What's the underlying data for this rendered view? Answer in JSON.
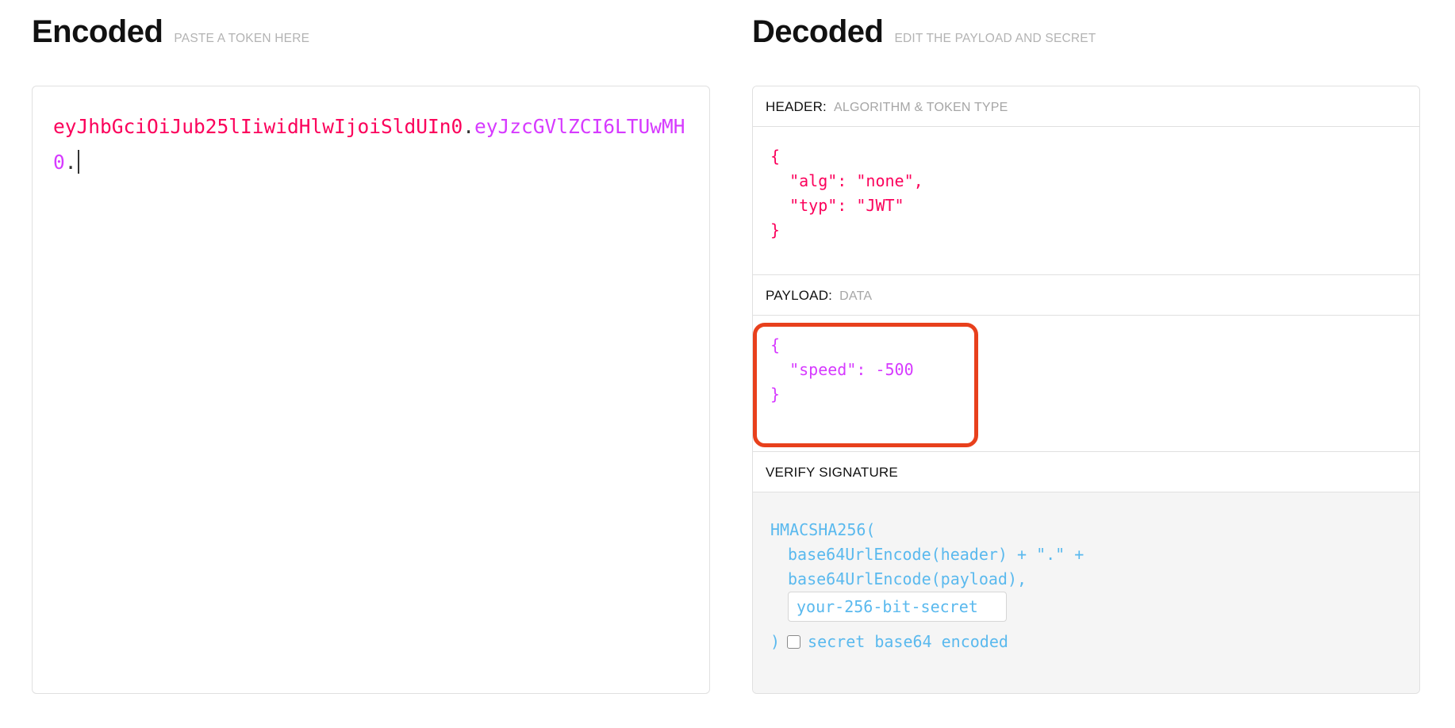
{
  "encoded": {
    "title": "Encoded",
    "subtitle": "PASTE A TOKEN HERE",
    "token_header_part": "eyJhbGciOiJub25lIiwidHlwIjoiSldUIn0",
    "token_separator_1": ".",
    "token_payload_part": "eyJzcGVlZCI6LTUwMH0",
    "token_separator_2": ".",
    "token_full": "eyJhbGciOiJub25lIiwidHlwIjoiSldUIn0.eyJzcGVlZCI6LTUwMH0."
  },
  "decoded": {
    "title": "Decoded",
    "subtitle": "EDIT THE PAYLOAD AND SECRET",
    "header_section": {
      "label": "HEADER:",
      "sublabel": "ALGORITHM & TOKEN TYPE",
      "json": "{\n  \"alg\": \"none\",\n  \"typ\": \"JWT\"\n}",
      "alg": "none",
      "typ": "JWT"
    },
    "payload_section": {
      "label": "PAYLOAD:",
      "sublabel": "DATA",
      "json": "{\n  \"speed\": -500\n}",
      "speed": -500
    },
    "signature_section": {
      "label": "VERIFY SIGNATURE",
      "line1": "HMACSHA256(",
      "line2": "base64UrlEncode(header) + \".\" +",
      "line3": "base64UrlEncode(payload),",
      "secret_value": "your-256-bit-secret",
      "secret_placeholder": "your-256-bit-secret",
      "close_paren": ")",
      "base64_checkbox_label": "secret base64 encoded",
      "base64_checkbox_checked": false
    }
  },
  "colors": {
    "header_token": "#fb015b",
    "payload_token": "#d63aff",
    "signature_token": "#5ab9ee",
    "annotation_box": "#e8401c",
    "panel_border": "#e0e0e0",
    "signature_background": "#f5f5f5",
    "subtitle_gray": "#b3b3b3"
  }
}
